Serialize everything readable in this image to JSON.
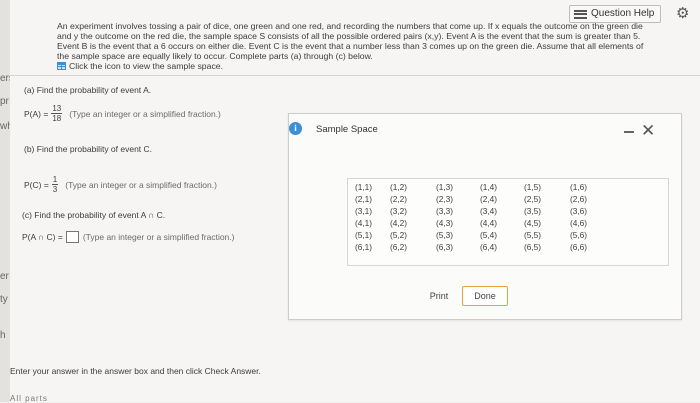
{
  "header": {
    "help_label": "Question Help",
    "intro_lines": [
      "An experiment involves tossing a pair of dice, one green and one red, and recording the numbers that come up. If x equals the outcome on the green die",
      "and y the outcome on the red die, the sample space S consists of all the possible ordered pairs (x,y). Event A is the event that the sum is greater than 5.",
      "Event B is the event that a 6 occurs on either die. Event C is the event that a number less than 3 comes up on the green die. Assume that all elements of",
      "the sample space are equally likely to occur. Complete parts (a) through (c) below."
    ],
    "sample_link": "Click the icon to view the sample space."
  },
  "left_fragments": [
    "ers",
    "pr",
    "wh",
    "er",
    "ty",
    "h"
  ],
  "parts": {
    "a": {
      "label": "(a) Find the probability of event A.",
      "lhs": "P(A) =",
      "num": "13",
      "den": "18",
      "hint": "(Type an integer or a simplified fraction.)"
    },
    "b": {
      "label": "(b) Find the probability of event C.",
      "lhs": "P(C) =",
      "num": "1",
      "den": "3",
      "hint": "(Type an integer or a simplified fraction.)"
    },
    "c": {
      "label": "(c) Find the probability of event A ∩ C.",
      "lhs": "P(A ∩ C) =",
      "hint": "(Type an integer or a simplified fraction.)"
    }
  },
  "modal": {
    "title": "Sample Space",
    "columns": [
      [
        "(1,1)",
        "(2,1)",
        "(3,1)",
        "(4,1)",
        "(5,1)",
        "(6,1)"
      ],
      [
        "(1,2)",
        "(2,2)",
        "(3,2)",
        "(4,2)",
        "(5,2)",
        "(6,2)"
      ],
      [
        "(1,3)",
        "(2,3)",
        "(3,3)",
        "(4,3)",
        "(5,3)",
        "(6,3)"
      ],
      [
        "(1,4)",
        "(2,4)",
        "(3,4)",
        "(4,4)",
        "(5,4)",
        "(6,4)"
      ],
      [
        "(1,5)",
        "(2,5)",
        "(3,5)",
        "(4,5)",
        "(5,5)",
        "(6,5)"
      ],
      [
        "(1,6)",
        "(2,6)",
        "(3,6)",
        "(4,6)",
        "(5,6)",
        "(6,6)"
      ]
    ],
    "print_label": "Print",
    "done_label": "Done"
  },
  "footer": {
    "instruction": "Enter your answer in the answer box and then click Check Answer.",
    "partial": "All parts"
  },
  "colors": {
    "accent": "#3a8fd6",
    "done_border": "#e4a33c"
  }
}
